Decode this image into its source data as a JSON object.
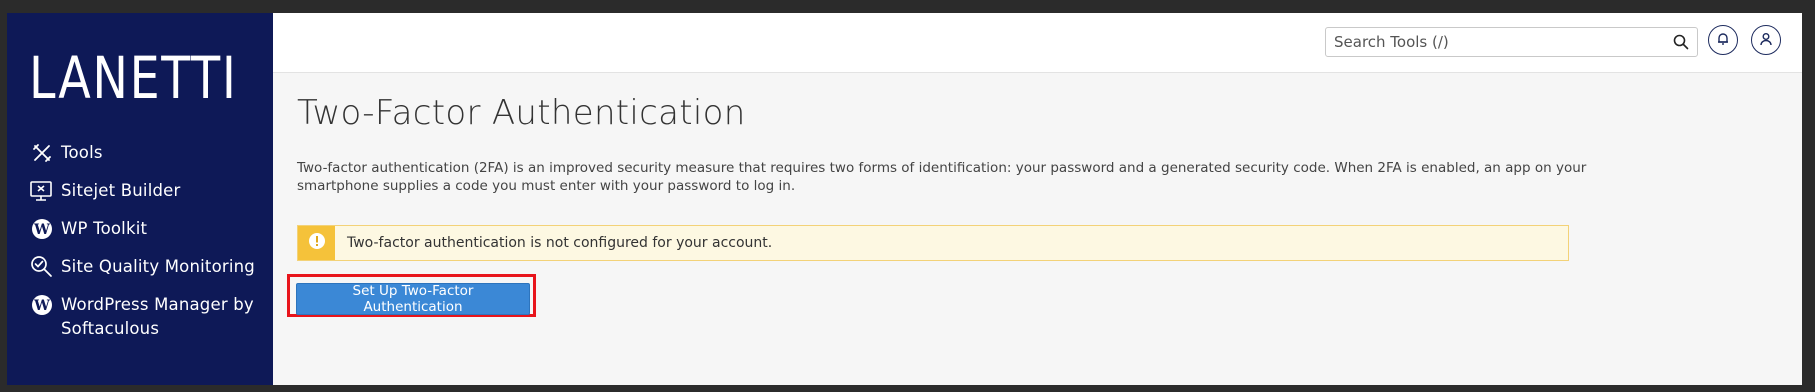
{
  "brand": {
    "logo_text": "LANETTI"
  },
  "sidebar": {
    "items": [
      {
        "label": "Tools",
        "icon": "tools-icon"
      },
      {
        "label": "Sitejet Builder",
        "icon": "sitejet-icon"
      },
      {
        "label": "WP Toolkit",
        "icon": "wordpress-icon"
      },
      {
        "label": "Site Quality Monitoring",
        "icon": "site-quality-icon"
      },
      {
        "label": "WordPress Manager by",
        "label2": "Softaculous",
        "icon": "wordpress-icon"
      }
    ]
  },
  "header": {
    "search": {
      "placeholder": "Search Tools (/)"
    },
    "icons": [
      "search-icon",
      "bell-icon",
      "user-icon"
    ]
  },
  "main": {
    "title": "Two-Factor Authentication",
    "description": "Two-factor authentication (2FA) is an improved security measure that requires two forms of identification: your password and a generated security code. When 2FA is enabled, an app on your smartphone supplies a code you must enter with your password to log in.",
    "alert": {
      "text": "Two-factor authentication is not configured for your account.",
      "icon": "warning-icon"
    },
    "setup_button": "Set Up Two-Factor Authentication"
  },
  "colors": {
    "sidebar_bg": "#0e1957",
    "primary_button": "#3b88d6",
    "alert_bg": "#fdf8e2",
    "alert_icon": "#f5c23a",
    "highlight": "#e8141b"
  }
}
